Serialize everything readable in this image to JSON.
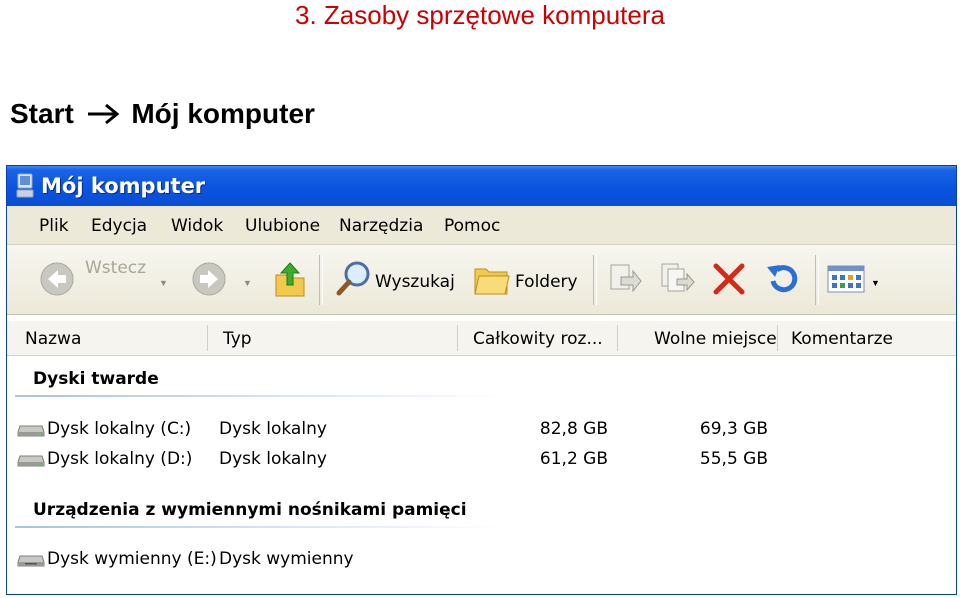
{
  "slide": {
    "title": "3. Zasoby sprzętowe komputera",
    "path_start": "Start",
    "path_target": "Mój komputer"
  },
  "window": {
    "title": "Mój komputer",
    "menu": [
      "Plik",
      "Edycja",
      "Widok",
      "Ulubione",
      "Narzędzia",
      "Pomoc"
    ],
    "toolbar": {
      "back": "Wstecz",
      "search": "Wyszukaj",
      "folders": "Foldery"
    },
    "columns": [
      "Nazwa",
      "Typ",
      "Całkowity roz...",
      "Wolne miejsce",
      "Komentarze"
    ],
    "groups": [
      {
        "title": "Dyski twarde",
        "items": [
          {
            "name": "Dysk lokalny (C:)",
            "type": "Dysk lokalny",
            "total": "82,8 GB",
            "free": "69,3 GB"
          },
          {
            "name": "Dysk lokalny (D:)",
            "type": "Dysk lokalny",
            "total": "61,2 GB",
            "free": "55,5 GB"
          }
        ]
      },
      {
        "title": "Urządzenia z wymiennymi nośnikami pamięci",
        "items": [
          {
            "name": "Dysk wymienny (E:)",
            "type": "Dysk wymienny"
          }
        ]
      }
    ]
  },
  "icons": {
    "window": "computer-icon",
    "back": "back-arrow-icon",
    "forward": "forward-arrow-icon",
    "up": "folder-up-icon",
    "search": "magnifier-icon",
    "folders": "folders-icon",
    "move_to": "move-to-icon",
    "copy_to": "copy-to-icon",
    "delete": "delete-icon",
    "undo": "undo-icon",
    "views": "views-icon",
    "drive": "hard-drive-icon"
  },
  "colors": {
    "title_red": "#cc0000",
    "titlebar_blue": "#0a54e0",
    "toolbar_bg": "#ece9d8",
    "delete_red": "#d42a1a",
    "undo_blue": "#2b6fd6"
  }
}
